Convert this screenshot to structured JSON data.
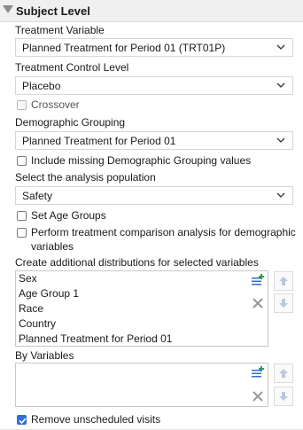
{
  "section": {
    "title": "Subject Level"
  },
  "treatment_variable": {
    "label": "Treatment Variable",
    "value": "Planned Treatment for Period 01 (TRT01P)"
  },
  "treatment_control": {
    "label": "Treatment Control Level",
    "value": "Placebo"
  },
  "crossover": {
    "label": "Crossover",
    "checked": false,
    "enabled": false
  },
  "demographic_grouping": {
    "label": "Demographic Grouping",
    "value": "Planned Treatment for Period 01"
  },
  "include_missing": {
    "label": "Include missing Demographic Grouping values",
    "checked": false
  },
  "analysis_population": {
    "label": "Select the analysis population",
    "value": "Safety"
  },
  "set_age_groups": {
    "label": "Set Age Groups",
    "checked": false
  },
  "perform_comparison": {
    "label_line1": "Perform treatment comparison analysis for demographic",
    "label_line2": "variables",
    "checked": false
  },
  "distributions": {
    "label": "Create additional distributions for selected variables",
    "items": [
      "Sex",
      "Age Group 1",
      "Race",
      "Country",
      "Planned Treatment for Period 01"
    ]
  },
  "by_variables": {
    "label": "By Variables",
    "items": []
  },
  "remove_unscheduled": {
    "label": "Remove unscheduled visits",
    "checked": true
  },
  "icons": {
    "add": "add-list-icon",
    "remove": "remove-x-icon",
    "up": "arrow-up-icon",
    "down": "arrow-down-icon",
    "collapse": "collapse-triangle-icon",
    "dropdown": "chevron-down-icon"
  },
  "colors": {
    "accent": "#2f6fd6",
    "header_bg": "#f0f0f0"
  }
}
